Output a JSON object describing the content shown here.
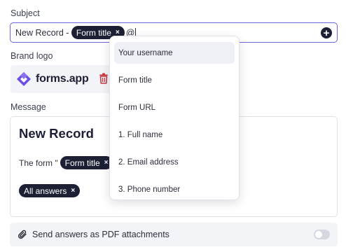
{
  "subject": {
    "label": "Subject",
    "prefix_text": "New Record - ",
    "chip_label": "Form title",
    "chip_remove": "×",
    "typed_text": "@",
    "add_button": "+"
  },
  "brand_logo": {
    "label": "Brand logo",
    "logo_text": "forms.app"
  },
  "message": {
    "label": "Message",
    "heading": "New Record",
    "line_prefix": "The form \"",
    "line_chip": "Form title",
    "chip_remove": "×",
    "line_suffix": "\"",
    "answers_chip": "All answers"
  },
  "mention_dropdown": {
    "items": [
      {
        "label": "Your username",
        "active": true
      },
      {
        "label": "Form title"
      },
      {
        "label": "Form URL"
      },
      {
        "label": "1. Full name"
      },
      {
        "label": "2. Email address"
      },
      {
        "label": "3. Phone number"
      }
    ]
  },
  "pdf_option": {
    "label": "Send answers as PDF attachments",
    "enabled": false
  },
  "colors": {
    "accent": "#6b63d8",
    "chip_bg": "#1d2035",
    "logo_purple": "#6b4ee6",
    "trash_red": "#c8373e"
  }
}
